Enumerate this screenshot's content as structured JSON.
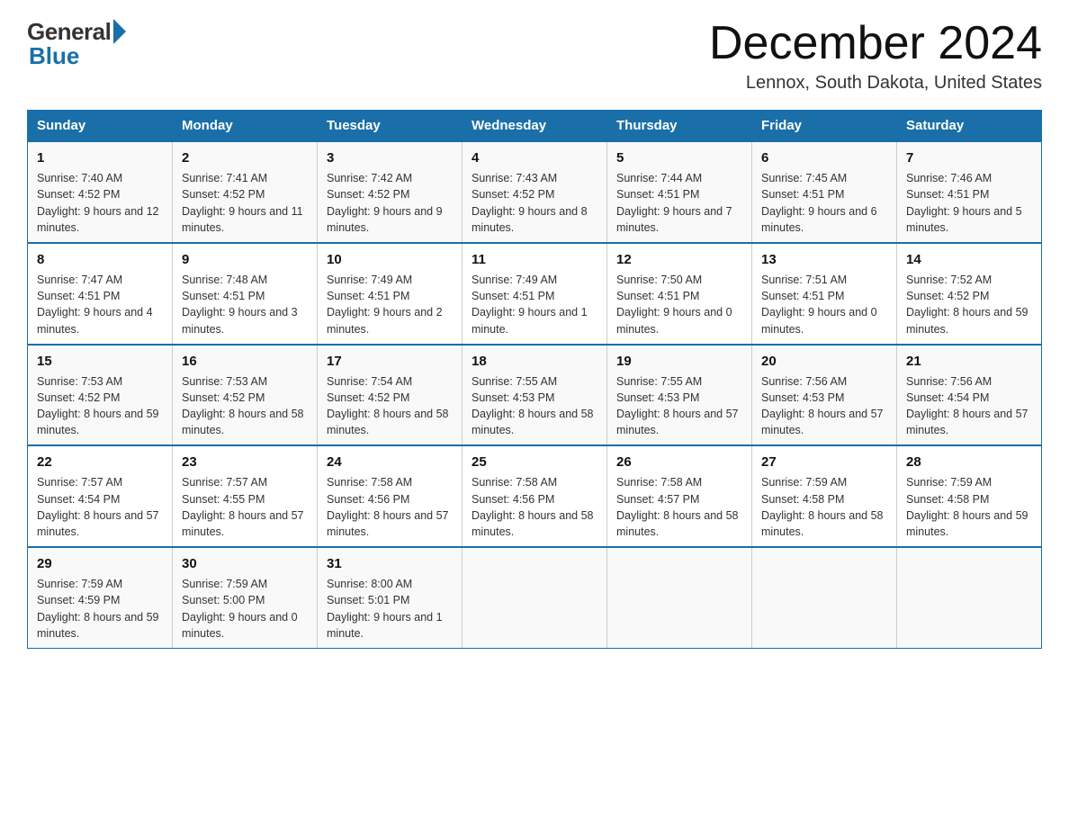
{
  "header": {
    "logo_general": "General",
    "logo_blue": "Blue",
    "month_title": "December 2024",
    "location": "Lennox, South Dakota, United States"
  },
  "days_of_week": [
    "Sunday",
    "Monday",
    "Tuesday",
    "Wednesday",
    "Thursday",
    "Friday",
    "Saturday"
  ],
  "weeks": [
    [
      {
        "day": "1",
        "sunrise": "7:40 AM",
        "sunset": "4:52 PM",
        "daylight": "9 hours and 12 minutes."
      },
      {
        "day": "2",
        "sunrise": "7:41 AM",
        "sunset": "4:52 PM",
        "daylight": "9 hours and 11 minutes."
      },
      {
        "day": "3",
        "sunrise": "7:42 AM",
        "sunset": "4:52 PM",
        "daylight": "9 hours and 9 minutes."
      },
      {
        "day": "4",
        "sunrise": "7:43 AM",
        "sunset": "4:52 PM",
        "daylight": "9 hours and 8 minutes."
      },
      {
        "day": "5",
        "sunrise": "7:44 AM",
        "sunset": "4:51 PM",
        "daylight": "9 hours and 7 minutes."
      },
      {
        "day": "6",
        "sunrise": "7:45 AM",
        "sunset": "4:51 PM",
        "daylight": "9 hours and 6 minutes."
      },
      {
        "day": "7",
        "sunrise": "7:46 AM",
        "sunset": "4:51 PM",
        "daylight": "9 hours and 5 minutes."
      }
    ],
    [
      {
        "day": "8",
        "sunrise": "7:47 AM",
        "sunset": "4:51 PM",
        "daylight": "9 hours and 4 minutes."
      },
      {
        "day": "9",
        "sunrise": "7:48 AM",
        "sunset": "4:51 PM",
        "daylight": "9 hours and 3 minutes."
      },
      {
        "day": "10",
        "sunrise": "7:49 AM",
        "sunset": "4:51 PM",
        "daylight": "9 hours and 2 minutes."
      },
      {
        "day": "11",
        "sunrise": "7:49 AM",
        "sunset": "4:51 PM",
        "daylight": "9 hours and 1 minute."
      },
      {
        "day": "12",
        "sunrise": "7:50 AM",
        "sunset": "4:51 PM",
        "daylight": "9 hours and 0 minutes."
      },
      {
        "day": "13",
        "sunrise": "7:51 AM",
        "sunset": "4:51 PM",
        "daylight": "9 hours and 0 minutes."
      },
      {
        "day": "14",
        "sunrise": "7:52 AM",
        "sunset": "4:52 PM",
        "daylight": "8 hours and 59 minutes."
      }
    ],
    [
      {
        "day": "15",
        "sunrise": "7:53 AM",
        "sunset": "4:52 PM",
        "daylight": "8 hours and 59 minutes."
      },
      {
        "day": "16",
        "sunrise": "7:53 AM",
        "sunset": "4:52 PM",
        "daylight": "8 hours and 58 minutes."
      },
      {
        "day": "17",
        "sunrise": "7:54 AM",
        "sunset": "4:52 PM",
        "daylight": "8 hours and 58 minutes."
      },
      {
        "day": "18",
        "sunrise": "7:55 AM",
        "sunset": "4:53 PM",
        "daylight": "8 hours and 58 minutes."
      },
      {
        "day": "19",
        "sunrise": "7:55 AM",
        "sunset": "4:53 PM",
        "daylight": "8 hours and 57 minutes."
      },
      {
        "day": "20",
        "sunrise": "7:56 AM",
        "sunset": "4:53 PM",
        "daylight": "8 hours and 57 minutes."
      },
      {
        "day": "21",
        "sunrise": "7:56 AM",
        "sunset": "4:54 PM",
        "daylight": "8 hours and 57 minutes."
      }
    ],
    [
      {
        "day": "22",
        "sunrise": "7:57 AM",
        "sunset": "4:54 PM",
        "daylight": "8 hours and 57 minutes."
      },
      {
        "day": "23",
        "sunrise": "7:57 AM",
        "sunset": "4:55 PM",
        "daylight": "8 hours and 57 minutes."
      },
      {
        "day": "24",
        "sunrise": "7:58 AM",
        "sunset": "4:56 PM",
        "daylight": "8 hours and 57 minutes."
      },
      {
        "day": "25",
        "sunrise": "7:58 AM",
        "sunset": "4:56 PM",
        "daylight": "8 hours and 58 minutes."
      },
      {
        "day": "26",
        "sunrise": "7:58 AM",
        "sunset": "4:57 PM",
        "daylight": "8 hours and 58 minutes."
      },
      {
        "day": "27",
        "sunrise": "7:59 AM",
        "sunset": "4:58 PM",
        "daylight": "8 hours and 58 minutes."
      },
      {
        "day": "28",
        "sunrise": "7:59 AM",
        "sunset": "4:58 PM",
        "daylight": "8 hours and 59 minutes."
      }
    ],
    [
      {
        "day": "29",
        "sunrise": "7:59 AM",
        "sunset": "4:59 PM",
        "daylight": "8 hours and 59 minutes."
      },
      {
        "day": "30",
        "sunrise": "7:59 AM",
        "sunset": "5:00 PM",
        "daylight": "9 hours and 0 minutes."
      },
      {
        "day": "31",
        "sunrise": "8:00 AM",
        "sunset": "5:01 PM",
        "daylight": "9 hours and 1 minute."
      },
      null,
      null,
      null,
      null
    ]
  ],
  "labels": {
    "sunrise": "Sunrise:",
    "sunset": "Sunset:",
    "daylight": "Daylight:"
  }
}
